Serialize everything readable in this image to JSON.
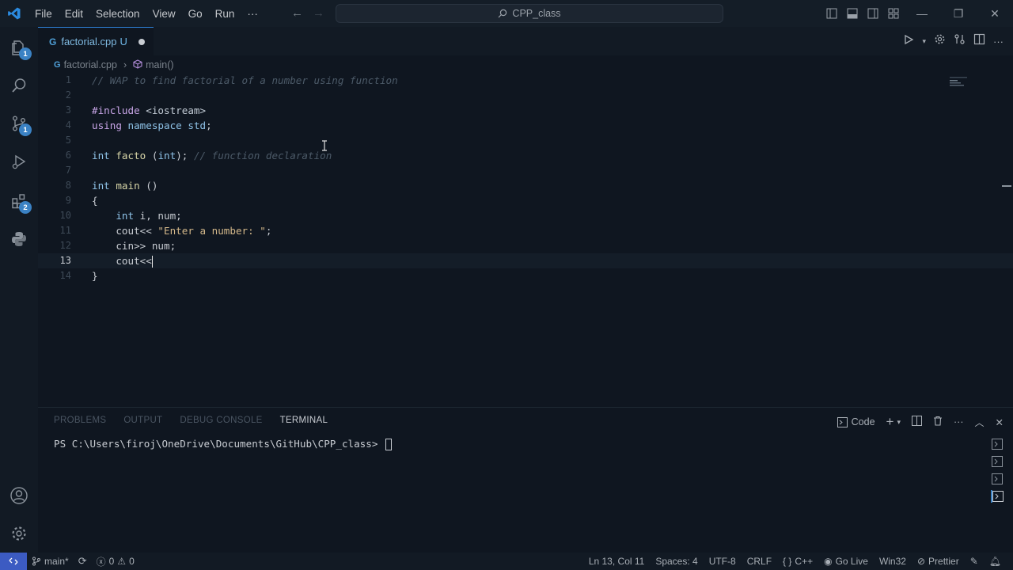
{
  "titlebar": {
    "menu": [
      "File",
      "Edit",
      "Selection",
      "View",
      "Go",
      "Run",
      "···"
    ],
    "search_text": "CPP_class"
  },
  "activitybar": {
    "explorer_badge": "1",
    "scm_badge": "1",
    "extensions_badge": "2"
  },
  "editor": {
    "tab": {
      "filename": "factorial.cpp",
      "status": "U"
    },
    "breadcrumb": {
      "file": "factorial.cpp",
      "symbol": "main()"
    },
    "active_line": 13,
    "lines": [
      {
        "n": "1",
        "parts": [
          {
            "c": "com",
            "t": "// WAP to find factorial of a number using function"
          }
        ]
      },
      {
        "n": "2",
        "parts": []
      },
      {
        "n": "3",
        "parts": [
          {
            "c": "kw2",
            "t": "#include"
          },
          {
            "c": "inc",
            "t": " <iostream>"
          }
        ]
      },
      {
        "n": "4",
        "parts": [
          {
            "c": "kw2",
            "t": "using"
          },
          {
            "c": "plain",
            "t": " "
          },
          {
            "c": "kw",
            "t": "namespace"
          },
          {
            "c": "plain",
            "t": " "
          },
          {
            "c": "kw",
            "t": "std"
          },
          {
            "c": "plain",
            "t": ";"
          }
        ]
      },
      {
        "n": "5",
        "parts": []
      },
      {
        "n": "6",
        "parts": [
          {
            "c": "kw",
            "t": "int"
          },
          {
            "c": "plain",
            "t": " "
          },
          {
            "c": "fn",
            "t": "facto"
          },
          {
            "c": "plain",
            "t": " ("
          },
          {
            "c": "kw",
            "t": "int"
          },
          {
            "c": "plain",
            "t": "); "
          },
          {
            "c": "com",
            "t": "// function declaration"
          }
        ]
      },
      {
        "n": "7",
        "parts": []
      },
      {
        "n": "8",
        "parts": [
          {
            "c": "kw",
            "t": "int"
          },
          {
            "c": "plain",
            "t": " "
          },
          {
            "c": "fn",
            "t": "main"
          },
          {
            "c": "plain",
            "t": " ()"
          }
        ]
      },
      {
        "n": "9",
        "parts": [
          {
            "c": "plain",
            "t": "{"
          }
        ]
      },
      {
        "n": "10",
        "parts": [
          {
            "c": "plain",
            "t": "    "
          },
          {
            "c": "kw",
            "t": "int"
          },
          {
            "c": "plain",
            "t": " i, num;"
          }
        ]
      },
      {
        "n": "11",
        "parts": [
          {
            "c": "plain",
            "t": "    cout<< "
          },
          {
            "c": "str",
            "t": "\"Enter a number: \""
          },
          {
            "c": "plain",
            "t": ";"
          }
        ]
      },
      {
        "n": "12",
        "parts": [
          {
            "c": "plain",
            "t": "    cin>> num;"
          }
        ]
      },
      {
        "n": "13",
        "parts": [
          {
            "c": "plain",
            "t": "    cout<<"
          }
        ]
      },
      {
        "n": "14",
        "parts": [
          {
            "c": "plain",
            "t": "}"
          }
        ]
      }
    ]
  },
  "panel": {
    "tabs": [
      "PROBLEMS",
      "OUTPUT",
      "DEBUG CONSOLE",
      "TERMINAL"
    ],
    "active_tab": "TERMINAL",
    "terminal_profile": "Code",
    "prompt": "PS C:\\Users\\firoj\\OneDrive\\Documents\\GitHub\\CPP_class> "
  },
  "statusbar": {
    "branch": "main*",
    "errors": "0",
    "warnings": "0",
    "position": "Ln 13, Col 11",
    "spaces": "Spaces: 4",
    "encoding": "UTF-8",
    "eol": "CRLF",
    "language": "C++",
    "golive": "Go Live",
    "platform": "Win32",
    "prettier": "Prettier"
  }
}
